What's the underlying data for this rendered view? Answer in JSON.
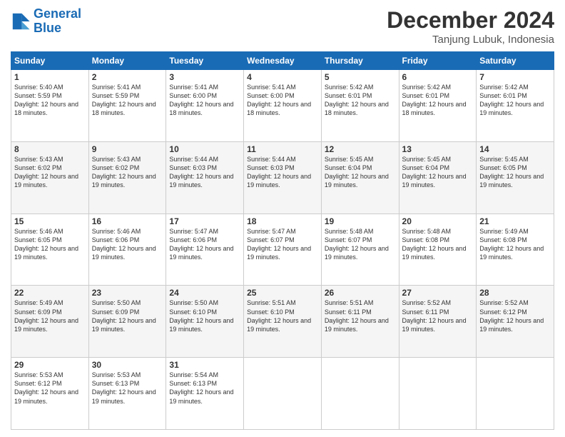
{
  "header": {
    "logo_line1": "General",
    "logo_line2": "Blue",
    "month_title": "December 2024",
    "location": "Tanjung Lubuk, Indonesia"
  },
  "days_of_week": [
    "Sunday",
    "Monday",
    "Tuesday",
    "Wednesday",
    "Thursday",
    "Friday",
    "Saturday"
  ],
  "weeks": [
    [
      {
        "day": "1",
        "sunrise": "5:40 AM",
        "sunset": "5:59 PM",
        "daylight": "12 hours and 18 minutes."
      },
      {
        "day": "2",
        "sunrise": "5:41 AM",
        "sunset": "5:59 PM",
        "daylight": "12 hours and 18 minutes."
      },
      {
        "day": "3",
        "sunrise": "5:41 AM",
        "sunset": "6:00 PM",
        "daylight": "12 hours and 18 minutes."
      },
      {
        "day": "4",
        "sunrise": "5:41 AM",
        "sunset": "6:00 PM",
        "daylight": "12 hours and 18 minutes."
      },
      {
        "day": "5",
        "sunrise": "5:42 AM",
        "sunset": "6:01 PM",
        "daylight": "12 hours and 18 minutes."
      },
      {
        "day": "6",
        "sunrise": "5:42 AM",
        "sunset": "6:01 PM",
        "daylight": "12 hours and 18 minutes."
      },
      {
        "day": "7",
        "sunrise": "5:42 AM",
        "sunset": "6:01 PM",
        "daylight": "12 hours and 19 minutes."
      }
    ],
    [
      {
        "day": "8",
        "sunrise": "5:43 AM",
        "sunset": "6:02 PM",
        "daylight": "12 hours and 19 minutes."
      },
      {
        "day": "9",
        "sunrise": "5:43 AM",
        "sunset": "6:02 PM",
        "daylight": "12 hours and 19 minutes."
      },
      {
        "day": "10",
        "sunrise": "5:44 AM",
        "sunset": "6:03 PM",
        "daylight": "12 hours and 19 minutes."
      },
      {
        "day": "11",
        "sunrise": "5:44 AM",
        "sunset": "6:03 PM",
        "daylight": "12 hours and 19 minutes."
      },
      {
        "day": "12",
        "sunrise": "5:45 AM",
        "sunset": "6:04 PM",
        "daylight": "12 hours and 19 minutes."
      },
      {
        "day": "13",
        "sunrise": "5:45 AM",
        "sunset": "6:04 PM",
        "daylight": "12 hours and 19 minutes."
      },
      {
        "day": "14",
        "sunrise": "5:45 AM",
        "sunset": "6:05 PM",
        "daylight": "12 hours and 19 minutes."
      }
    ],
    [
      {
        "day": "15",
        "sunrise": "5:46 AM",
        "sunset": "6:05 PM",
        "daylight": "12 hours and 19 minutes."
      },
      {
        "day": "16",
        "sunrise": "5:46 AM",
        "sunset": "6:06 PM",
        "daylight": "12 hours and 19 minutes."
      },
      {
        "day": "17",
        "sunrise": "5:47 AM",
        "sunset": "6:06 PM",
        "daylight": "12 hours and 19 minutes."
      },
      {
        "day": "18",
        "sunrise": "5:47 AM",
        "sunset": "6:07 PM",
        "daylight": "12 hours and 19 minutes."
      },
      {
        "day": "19",
        "sunrise": "5:48 AM",
        "sunset": "6:07 PM",
        "daylight": "12 hours and 19 minutes."
      },
      {
        "day": "20",
        "sunrise": "5:48 AM",
        "sunset": "6:08 PM",
        "daylight": "12 hours and 19 minutes."
      },
      {
        "day": "21",
        "sunrise": "5:49 AM",
        "sunset": "6:08 PM",
        "daylight": "12 hours and 19 minutes."
      }
    ],
    [
      {
        "day": "22",
        "sunrise": "5:49 AM",
        "sunset": "6:09 PM",
        "daylight": "12 hours and 19 minutes."
      },
      {
        "day": "23",
        "sunrise": "5:50 AM",
        "sunset": "6:09 PM",
        "daylight": "12 hours and 19 minutes."
      },
      {
        "day": "24",
        "sunrise": "5:50 AM",
        "sunset": "6:10 PM",
        "daylight": "12 hours and 19 minutes."
      },
      {
        "day": "25",
        "sunrise": "5:51 AM",
        "sunset": "6:10 PM",
        "daylight": "12 hours and 19 minutes."
      },
      {
        "day": "26",
        "sunrise": "5:51 AM",
        "sunset": "6:11 PM",
        "daylight": "12 hours and 19 minutes."
      },
      {
        "day": "27",
        "sunrise": "5:52 AM",
        "sunset": "6:11 PM",
        "daylight": "12 hours and 19 minutes."
      },
      {
        "day": "28",
        "sunrise": "5:52 AM",
        "sunset": "6:12 PM",
        "daylight": "12 hours and 19 minutes."
      }
    ],
    [
      {
        "day": "29",
        "sunrise": "5:53 AM",
        "sunset": "6:12 PM",
        "daylight": "12 hours and 19 minutes."
      },
      {
        "day": "30",
        "sunrise": "5:53 AM",
        "sunset": "6:13 PM",
        "daylight": "12 hours and 19 minutes."
      },
      {
        "day": "31",
        "sunrise": "5:54 AM",
        "sunset": "6:13 PM",
        "daylight": "12 hours and 19 minutes."
      },
      null,
      null,
      null,
      null
    ]
  ]
}
